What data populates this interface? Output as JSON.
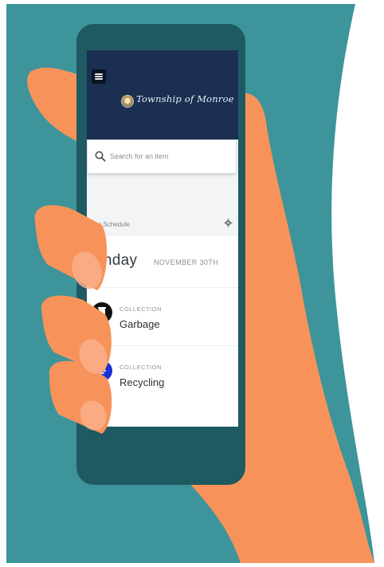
{
  "colors": {
    "teal_background": "#3d949a",
    "hand": "#f7935a",
    "phone_body": "#1f5a62",
    "header": "#1b2f52",
    "recycling_icon": "#1a2fd4"
  },
  "header": {
    "brand": "Township of Monroe",
    "menu_icon": "hamburger-menu-icon",
    "seal_icon": "township-seal-icon"
  },
  "search": {
    "placeholder": "Search for an item",
    "icon": "search-icon"
  },
  "schedule": {
    "label": "Your Schedule",
    "settings_icon": "gear-icon",
    "day": "onday",
    "date": "NOVEMBER 30TH",
    "items": [
      {
        "category": "COLLECTION",
        "name": "Garbage",
        "icon": "garbage-bin-icon"
      },
      {
        "category": "COLLECTION",
        "name": "Recycling",
        "icon": "recycling-icon"
      }
    ]
  }
}
